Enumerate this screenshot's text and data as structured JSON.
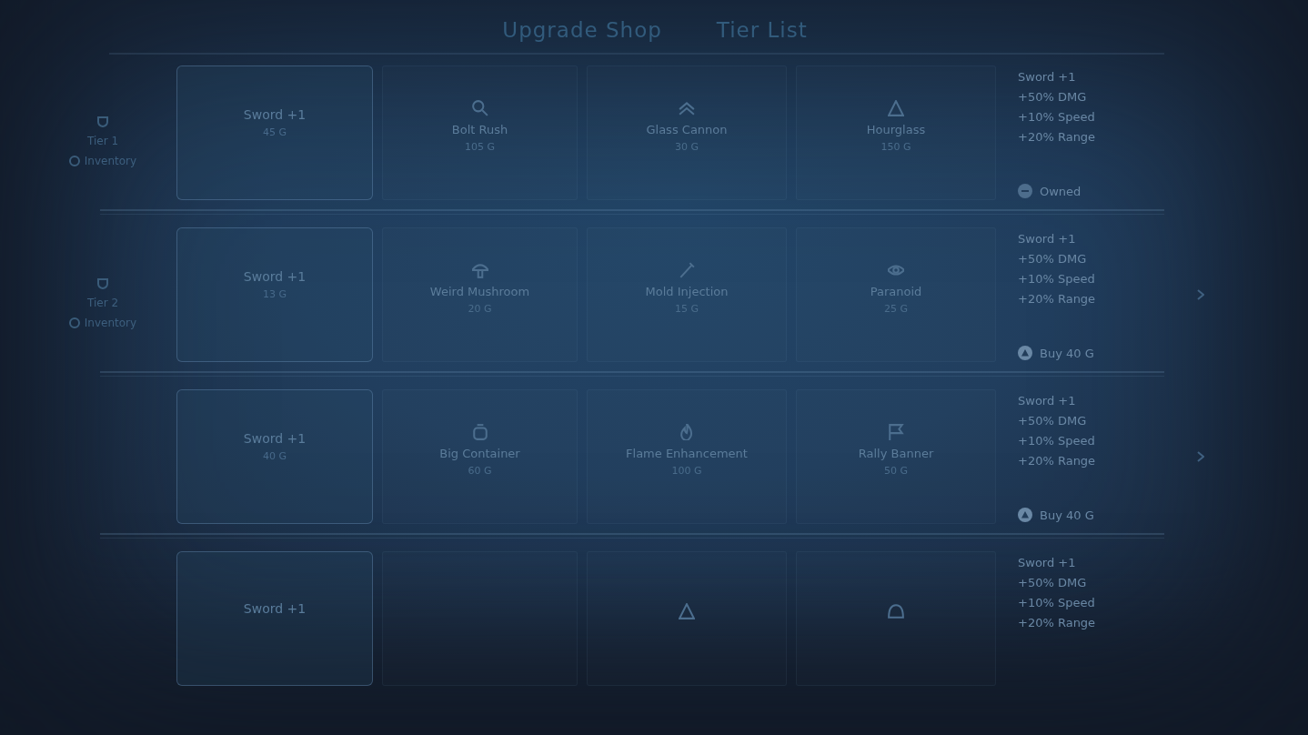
{
  "title": "Upgrade Shop",
  "subtitle": "Tier List",
  "rows": [
    {
      "label": "Tier 1",
      "link": "Inventory",
      "current": {
        "name": "Sword +1",
        "price": "45 G"
      },
      "options": [
        {
          "kind": "item",
          "name": "Bolt Rush",
          "price": "105 G"
        },
        {
          "kind": "item",
          "name": "Glass Cannon",
          "price": "30 G"
        },
        {
          "kind": "item",
          "name": "Hourglass",
          "price": "150 G"
        }
      ],
      "details": {
        "title": "Sword +1",
        "stats": [
          "+50% DMG",
          "+10% Speed",
          "+20% Range"
        ]
      },
      "action": {
        "kind": "owned",
        "label": "Owned"
      },
      "more": false
    },
    {
      "label": "Tier 2",
      "link": "Inventory",
      "current": {
        "name": "Sword +1",
        "price": "13 G"
      },
      "options": [
        {
          "kind": "item",
          "name": "Weird Mushroom",
          "price": "20 G"
        },
        {
          "kind": "item",
          "name": "Mold Injection",
          "price": "15 G"
        },
        {
          "kind": "item",
          "name": "Paranoid",
          "price": "25 G"
        }
      ],
      "details": {
        "title": "Sword +1",
        "stats": [
          "+50% DMG",
          "+10% Speed",
          "+20% Range"
        ]
      },
      "action": {
        "kind": "buy",
        "label": "Buy 40 G"
      },
      "more": true
    },
    {
      "current": {
        "name": "Sword +1",
        "price": "40 G"
      },
      "options": [
        {
          "kind": "item",
          "name": "Big Container",
          "price": "60 G"
        },
        {
          "kind": "item",
          "name": "Flame Enhancement",
          "price": "100 G"
        },
        {
          "kind": "item",
          "name": "Rally Banner",
          "price": "50 G"
        }
      ],
      "details": {
        "title": "Sword +1",
        "stats": [
          "+50% DMG",
          "+10% Speed",
          "+20% Range"
        ]
      },
      "action": {
        "kind": "buy",
        "label": "Buy 40 G"
      },
      "more": true
    },
    {
      "current": {
        "name": "Sword +1"
      },
      "options": [
        {
          "kind": "empty"
        },
        {
          "kind": "icon"
        },
        {
          "kind": "icon"
        }
      ],
      "details": {
        "title": "Sword +1",
        "stats": [
          "+50% DMG",
          "+10% Speed",
          "+20% Range"
        ]
      },
      "more": false
    }
  ]
}
